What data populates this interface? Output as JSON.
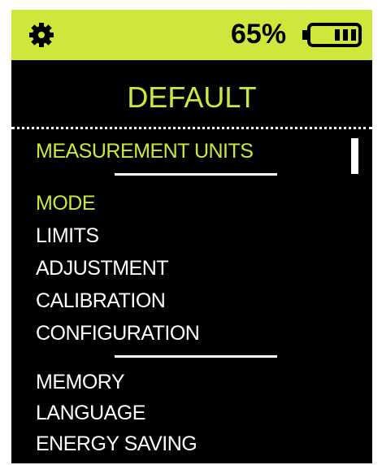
{
  "status_bar": {
    "battery_percent": "65%",
    "battery_level": 1.0,
    "icons": [
      "gear-icon",
      "battery-icon"
    ],
    "accent_color": "#cfe63d"
  },
  "screen": {
    "title": "DEFAULT"
  },
  "menu": {
    "items": [
      {
        "label": "MEASUREMENT UNITS",
        "state": "selected"
      },
      {
        "label": "MODE",
        "state": "highlighted"
      },
      {
        "label": "LIMITS"
      },
      {
        "label": "ADJUSTMENT"
      },
      {
        "label": "CALIBRATION"
      },
      {
        "label": "CONFIGURATION"
      },
      {
        "label": "MEMORY"
      },
      {
        "label": "LANGUAGE"
      },
      {
        "label": "ENERGY SAVING"
      }
    ]
  },
  "colors": {
    "accent": "#cfe63d",
    "background": "#000000",
    "text": "#ffffff"
  }
}
